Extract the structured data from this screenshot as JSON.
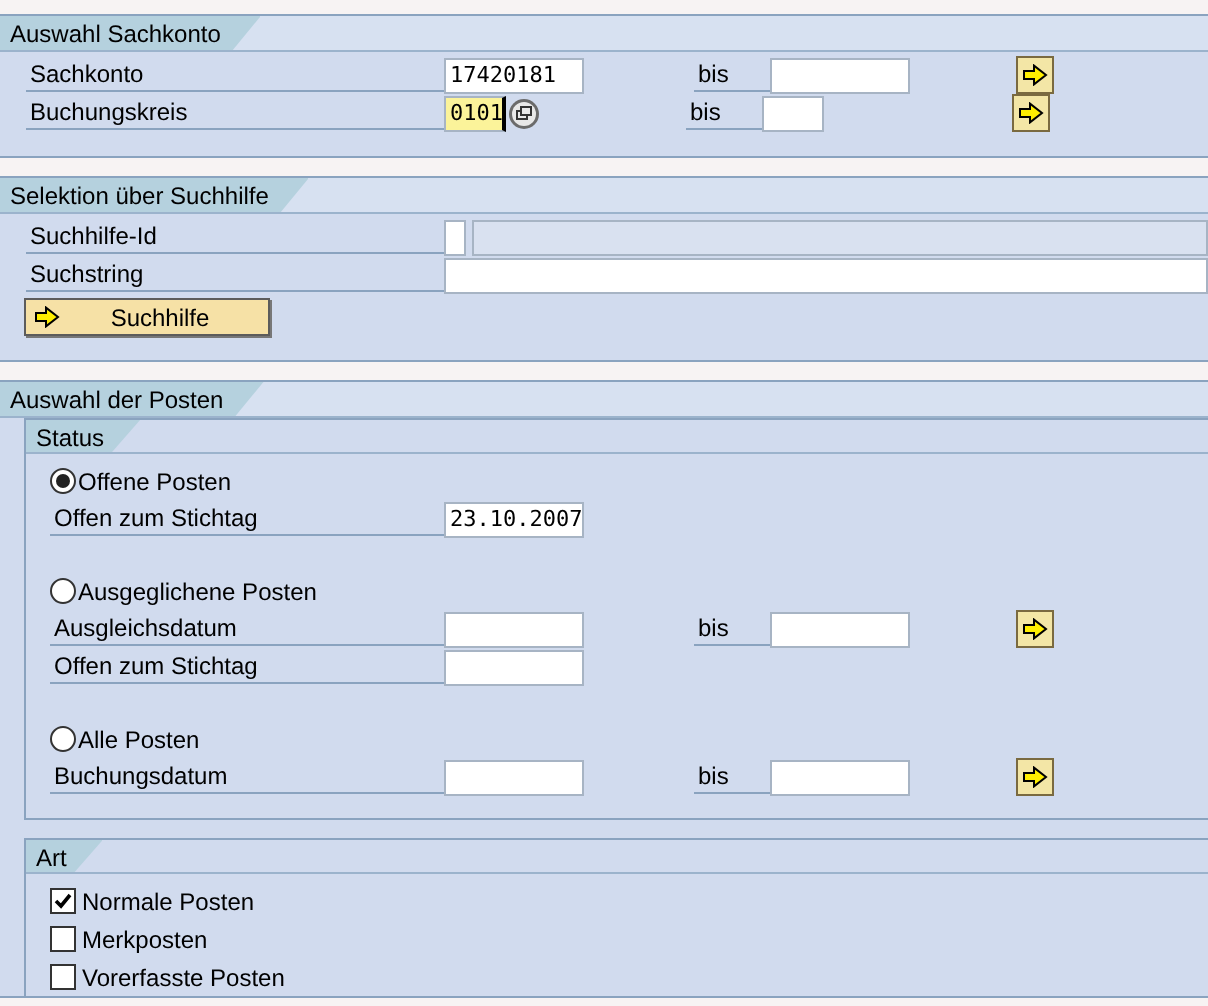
{
  "sections": [
    {
      "title": "Auswahl Sachkonto",
      "rows": [
        {
          "kind": "range",
          "label": "Sachkonto",
          "value": "17420181",
          "to_label": "bis",
          "to_short": false,
          "focused": false,
          "search_help": false
        },
        {
          "kind": "range",
          "label": "Buchungskreis",
          "value": "0101",
          "to_label": "bis",
          "to_short": true,
          "focused": true,
          "search_help": true
        }
      ]
    },
    {
      "title": "Selektion über Suchhilfe",
      "rows": [
        {
          "kind": "id",
          "label": "Suchhilfe-Id"
        },
        {
          "kind": "wide",
          "label": "Suchstring"
        },
        {
          "kind": "button",
          "label": "Suchhilfe"
        }
      ]
    },
    {
      "title": "Auswahl der Posten",
      "groups": [
        {
          "title": "Status",
          "options": [
            {
              "kind": "radio",
              "label": "Offene Posten",
              "selected": true,
              "rows": [
                {
                  "kind": "field",
                  "label": "Offen zum Stichtag",
                  "value": "23.10.2007"
                }
              ]
            },
            {
              "kind": "radio",
              "label": "Ausgeglichene Posten",
              "selected": false,
              "rows": [
                {
                  "kind": "range",
                  "label": "Ausgleichsdatum",
                  "to_label": "bis",
                  "to_short": false,
                  "focused": false,
                  "search_help": false
                },
                {
                  "kind": "field",
                  "label": "Offen zum Stichtag"
                }
              ]
            },
            {
              "kind": "radio",
              "label": "Alle Posten",
              "selected": false,
              "rows": [
                {
                  "kind": "range",
                  "label": "Buchungsdatum",
                  "to_label": "bis",
                  "to_short": false,
                  "focused": false,
                  "search_help": false
                }
              ]
            }
          ]
        },
        {
          "title": "Art",
          "options": [
            {
              "kind": "checkbox",
              "label": "Normale Posten",
              "checked": true
            },
            {
              "kind": "checkbox",
              "label": "Merkposten",
              "checked": false
            },
            {
              "kind": "checkbox",
              "label": "Vorerfasste Posten",
              "checked": false
            }
          ]
        }
      ]
    }
  ]
}
